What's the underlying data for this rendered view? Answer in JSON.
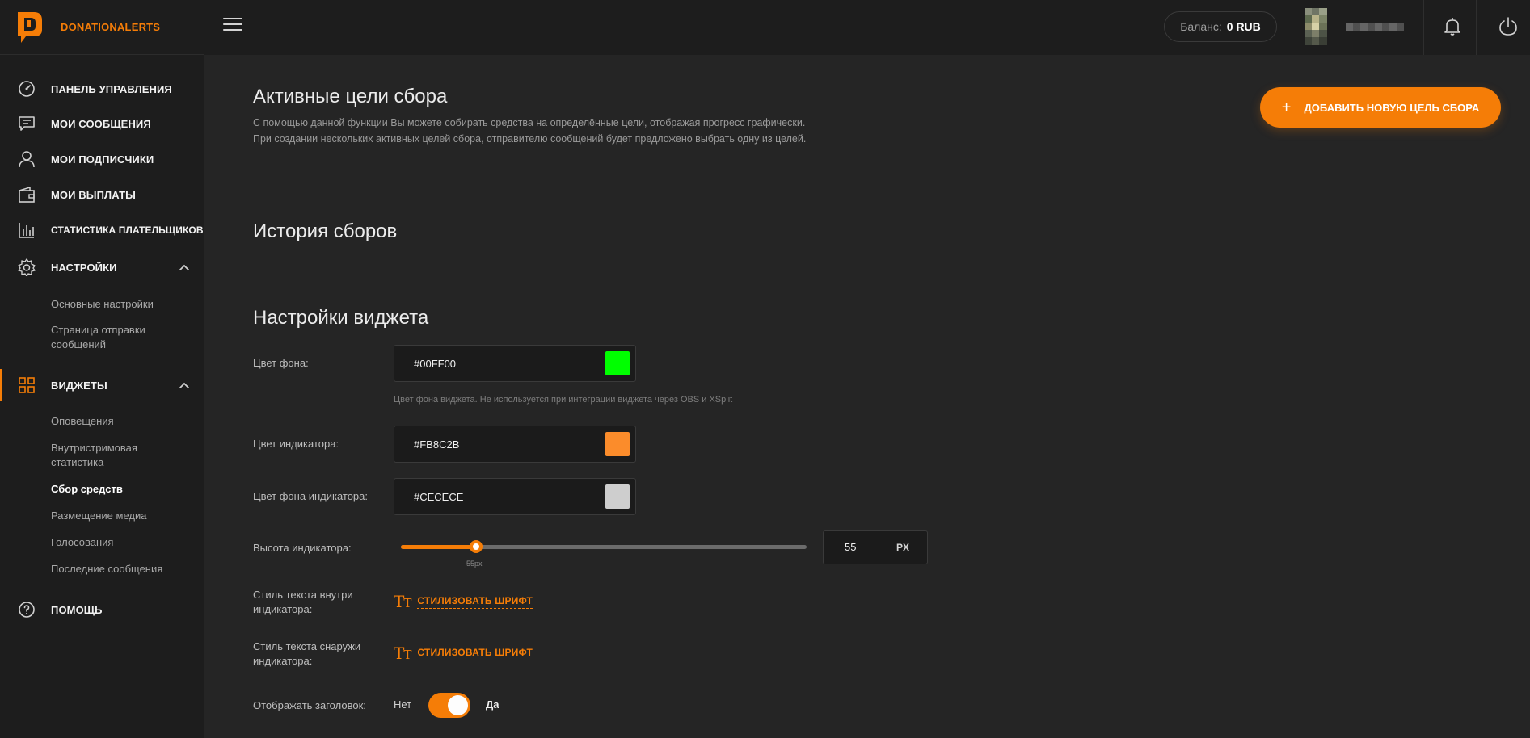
{
  "brand": {
    "name": "DONATIONALERTS",
    "accent": "#F57D07"
  },
  "topbar": {
    "balance_label": "Баланс:",
    "balance_value": "0 RUB"
  },
  "sidebar": {
    "items": [
      {
        "label": "ПАНЕЛЬ УПРАВЛЕНИЯ",
        "icon": "dashboard-icon"
      },
      {
        "label": "МОИ СООБЩЕНИЯ",
        "icon": "message-icon"
      },
      {
        "label": "МОИ ПОДПИСЧИКИ",
        "icon": "user-icon"
      },
      {
        "label": "МОИ ВЫПЛАТЫ",
        "icon": "wallet-icon"
      },
      {
        "label": "СТАТИСТИКА ПЛАТЕЛЬЩИКОВ",
        "icon": "bar-chart-icon"
      },
      {
        "label": "НАСТРОЙКИ",
        "icon": "gear-icon"
      },
      {
        "label": "ВИДЖЕТЫ",
        "icon": "widgets-icon"
      },
      {
        "label": "ПОМОЩЬ",
        "icon": "help-icon"
      }
    ],
    "settings_sub": [
      "Основные настройки",
      "Страница отправки сообщений"
    ],
    "widgets_sub": [
      "Оповещения",
      "Внутристримовая статистика",
      "Сбор средств",
      "Размещение медиа",
      "Голосования",
      "Последние сообщения"
    ]
  },
  "main": {
    "active_goals_title": "Активные цели сбора",
    "active_goals_desc_1": "С помощью данной функции Вы можете собирать средства на определённые цели, отображая прогресс графически.",
    "active_goals_desc_2": "При создании нескольких активных целей сбора, отправителю сообщений будет предложено выбрать одну из целей.",
    "add_goal_label": "ДОБАВИТЬ НОВУЮ ЦЕЛЬ СБОРА",
    "history_title": "История сборов",
    "widget_settings_title": "Настройки виджета",
    "bg_color_label": "Цвет фона:",
    "bg_color_value": "#00FF00",
    "bg_color_hint": "Цвет фона виджета. Не используется при интеграции виджета через OBS и XSplit",
    "indicator_color_label": "Цвет индикатора:",
    "indicator_color_value": "#FB8C2B",
    "indicator_bg_label": "Цвет фона индикатора:",
    "indicator_bg_value": "#CECECE",
    "height_label": "Высота индикатора:",
    "height_value": "55",
    "height_tip": "55px",
    "height_unit": "PX",
    "height_slider_fraction": 0.185,
    "inner_text_label": "Стиль текста внутри индикатора:",
    "outer_text_label": "Стиль текста снаружи индикатора:",
    "font_glyph": "T",
    "font_glyph_small": "T",
    "stylize_font_label": "СТИЛИЗОВАТЬ ШРИФТ",
    "show_header_label": "Отображать заголовок:",
    "toggle_no": "Нет",
    "toggle_yes": "Да"
  }
}
